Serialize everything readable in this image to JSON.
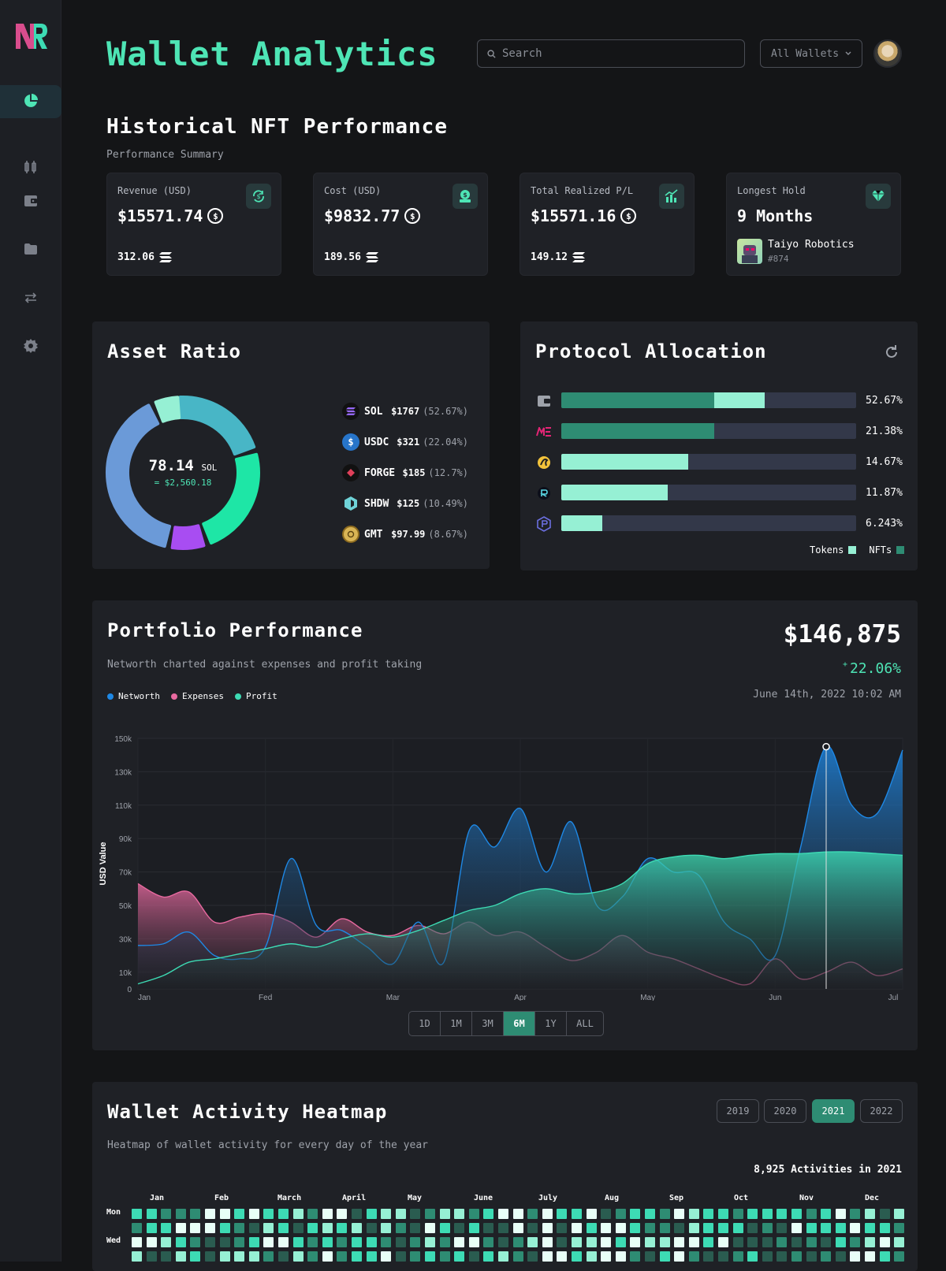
{
  "header": {
    "title": "Wallet Analytics",
    "search_placeholder": "Search",
    "wallet_filter": "All Wallets"
  },
  "sidebar": {
    "items": [
      "dashboard",
      "exchange",
      "wallet",
      "folder",
      "transfer",
      "settings"
    ],
    "active": "dashboard"
  },
  "nft_performance": {
    "title": "Historical NFT Performance",
    "subtitle": "Performance Summary",
    "cards": [
      {
        "label": "Revenue (USD)",
        "value": "$15571.74",
        "sub": "312.06",
        "icon": "refresh-dollar-icon"
      },
      {
        "label": "Cost (USD)",
        "value": "$9832.77",
        "sub": "189.56",
        "icon": "money-bag-icon"
      },
      {
        "label": "Total Realized P/L",
        "value": "$15571.16",
        "sub": "149.12",
        "icon": "chart-up-icon"
      },
      {
        "label": "Longest Hold",
        "value": "9 Months",
        "nft_name": "Taiyo Robotics",
        "nft_id": "#874",
        "icon": "diamond-icon"
      }
    ]
  },
  "asset_ratio": {
    "title": "Asset Ratio",
    "center_value": "78.14",
    "center_unit": "SOL",
    "center_usd": "= $2,560.18",
    "assets": [
      {
        "name": "SOL",
        "value": "$1767",
        "pct": "(52.67%)"
      },
      {
        "name": "USDC",
        "value": "$321",
        "pct": "(22.04%)"
      },
      {
        "name": "FORGE",
        "value": "$185",
        "pct": "(12.7%)"
      },
      {
        "name": "SHDW",
        "value": "$125",
        "pct": "(10.49%)"
      },
      {
        "name": "GMT",
        "value": "$97.99",
        "pct": "(8.67%)"
      }
    ]
  },
  "protocol_allocation": {
    "title": "Protocol Allocation",
    "legend_tokens": "Tokens",
    "legend_nfts": "NFTs",
    "rows": [
      {
        "icon": "wallet-icon",
        "pct_label": "52.67%",
        "nfts": 0.52,
        "tokens": 0.17
      },
      {
        "icon": "magic-eden-icon",
        "pct_label": "21.38%",
        "nfts": 0.52,
        "tokens": 0
      },
      {
        "icon": "solend-icon",
        "pct_label": "14.67%",
        "nfts": 0,
        "tokens": 0.43
      },
      {
        "icon": "raydium-icon",
        "pct_label": "11.87%",
        "nfts": 0,
        "tokens": 0.36
      },
      {
        "icon": "hex-protocol-icon",
        "pct_label": "6.243%",
        "nfts": 0,
        "tokens": 0.14
      }
    ]
  },
  "portfolio": {
    "title": "Portfolio Performance",
    "subtitle": "Networth charted against expenses and profit taking",
    "total": "$146,875",
    "change": "22.06%",
    "timestamp": "June 14th, 2022 10:02 AM",
    "ranges": [
      "1D",
      "1M",
      "3M",
      "6M",
      "1Y",
      "ALL"
    ],
    "active_range": "6M"
  },
  "chart_data": {
    "type": "area",
    "ylabel": "USD Value",
    "xlabel": "",
    "x_ticks": [
      "Jan",
      "Fed",
      "Mar",
      "Apr",
      "May",
      "Jun",
      "Jul"
    ],
    "y_ticks": [
      "0",
      "10k",
      "30k",
      "50k",
      "70k",
      "90k",
      "110k",
      "130k",
      "150k"
    ],
    "ylim": [
      0,
      150000
    ],
    "grid": true,
    "legend_position": "top-left",
    "series": [
      {
        "name": "Networth",
        "color": "#1e88e5",
        "values": [
          26000,
          27000,
          34000,
          20000,
          18000,
          25000,
          78000,
          38000,
          35000,
          25000,
          15000,
          40000,
          16000,
          95000,
          85000,
          108000,
          70000,
          100000,
          50000,
          55000,
          78000,
          70000,
          68000,
          40000,
          30000,
          20000,
          85000,
          145000,
          110000,
          105000,
          143000
        ]
      },
      {
        "name": "Expenses",
        "color": "#e86aa0",
        "values": [
          63000,
          55000,
          58000,
          40000,
          43000,
          45000,
          40000,
          31000,
          42000,
          34000,
          32000,
          38000,
          33000,
          40000,
          32000,
          34000,
          25000,
          17000,
          22000,
          32000,
          22000,
          18000,
          12000,
          6000,
          3000,
          18000,
          6000,
          10000,
          16000,
          8000,
          12000
        ]
      },
      {
        "name": "Profit",
        "color": "#3ddbb4",
        "values": [
          3000,
          8000,
          16000,
          18000,
          21000,
          24000,
          27000,
          25000,
          30000,
          33000,
          31000,
          35000,
          41000,
          47000,
          50000,
          57000,
          60000,
          57000,
          58000,
          63000,
          75000,
          79000,
          80000,
          78000,
          80000,
          81000,
          81000,
          82000,
          82000,
          81000,
          80000
        ]
      }
    ]
  },
  "heatmap": {
    "title": "Wallet Activity Heatmap",
    "subtitle": "Heatmap of wallet activity for every day of the year",
    "summary": "8,925 Activities in 2021",
    "years": [
      "2019",
      "2020",
      "2021",
      "2022"
    ],
    "active_year": "2021",
    "months": [
      "Jan",
      "Feb",
      "March",
      "April",
      "May",
      "June",
      "July",
      "Aug",
      "Sep",
      "Oct",
      "Nov",
      "Dec"
    ],
    "days": [
      "Mon",
      "Wed"
    ]
  }
}
